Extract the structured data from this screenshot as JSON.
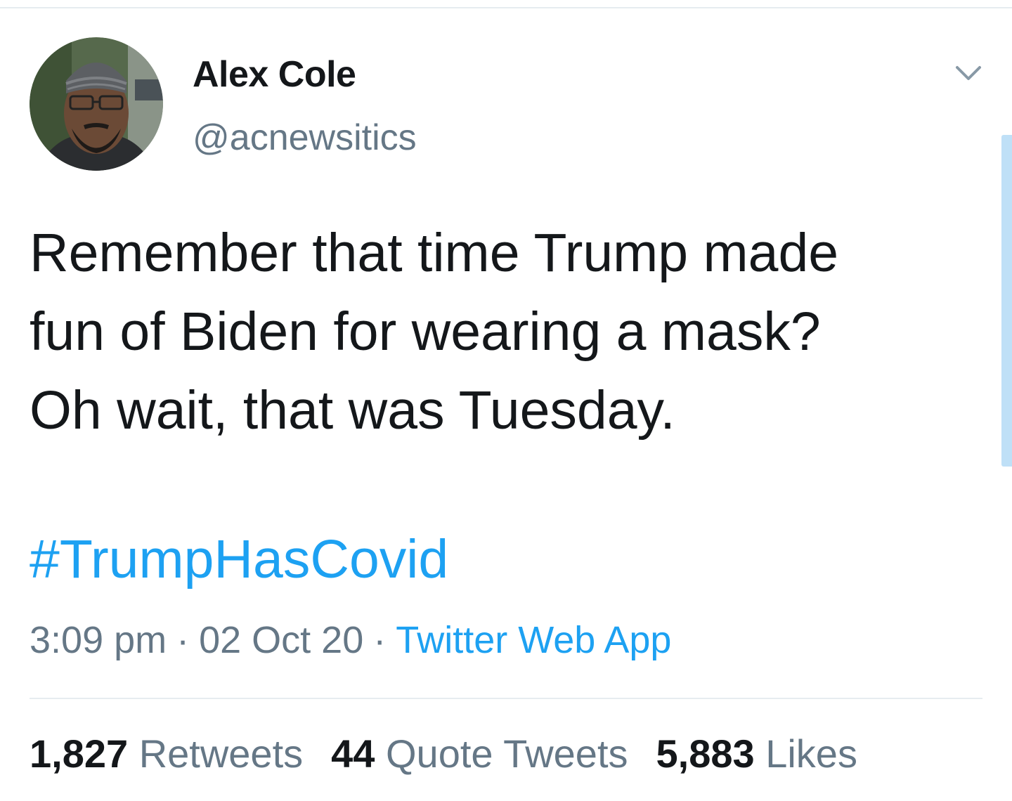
{
  "user": {
    "display_name": "Alex Cole",
    "handle": "@acnewsitics"
  },
  "tweet": {
    "text_lines": [
      "Remember that time Trump made",
      "fun of Biden for wearing a mask?",
      "Oh wait, that was Tuesday."
    ],
    "hashtag": "#TrumpHasCovid",
    "time": "3:09 pm",
    "date": "02 Oct 20",
    "separator": "·",
    "source": "Twitter Web App"
  },
  "stats": {
    "retweets": {
      "count": "1,827",
      "label": "Retweets"
    },
    "quote_tweets": {
      "count": "44",
      "label": "Quote Tweets"
    },
    "likes": {
      "count": "5,883",
      "label": "Likes"
    }
  },
  "icons": {
    "menu": "chevron-down-icon",
    "avatar": "avatar"
  },
  "colors": {
    "text": "#14171a",
    "secondary": "#657786",
    "accent": "#1da1f2",
    "divider": "#e6ecf0"
  }
}
